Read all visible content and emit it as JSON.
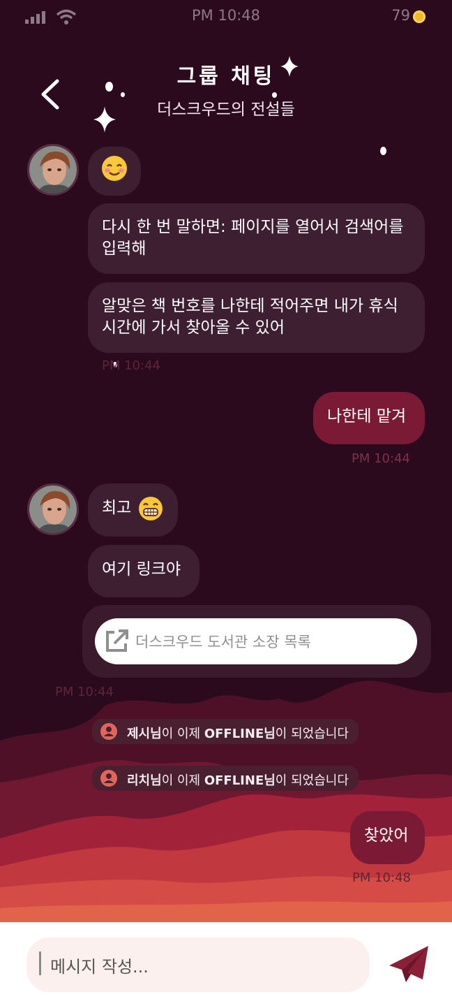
{
  "status": {
    "time": "PM 10:48",
    "coins": "79"
  },
  "header": {
    "title": "그룹 채팅",
    "subtitle": "더스크우드의 전설들"
  },
  "messages": {
    "m2": "다시 한 번 말하면: 페이지를 열어서 검색어를 입력해",
    "m3": "알맞은 책 번호를 나한테 적어주면 내가 휴식시간에 가서 찾아올 수 있어",
    "ts1": "PM 10:44",
    "m4": "나한테 맡겨",
    "ts2": "PM 10:44",
    "m5": "최고",
    "m6": "여기 링크야",
    "link": "더스크우드 도서관 소장 목록",
    "ts3": "PM 10:44",
    "m7": "찾았어",
    "ts4": "PM 10:48"
  },
  "system": {
    "s1_name": "제시님",
    "s2_name": "리치님",
    "mid": "이 이제 ",
    "state": "OFFLINE",
    "suffix": "님",
    "tail": "이 되었습니다"
  },
  "composer": {
    "placeholder": "메시지 작성..."
  },
  "colors": {
    "background": "#2a0a1c",
    "bubble_other": "#3e1f31",
    "bubble_mine": "#7b1a35",
    "accent": "#8b1f38"
  }
}
